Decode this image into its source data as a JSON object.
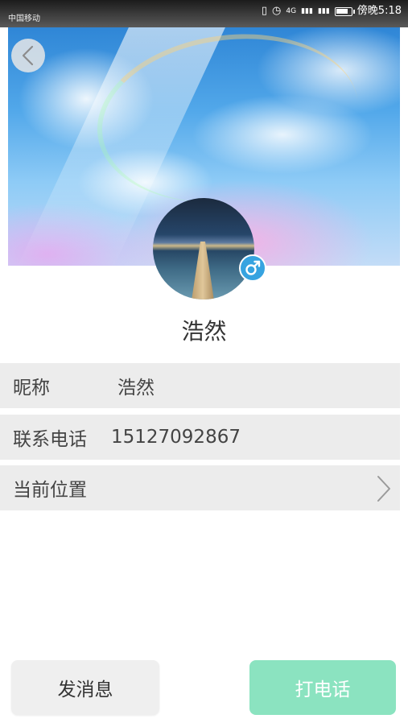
{
  "status_bar": {
    "carrier": "中国移动",
    "network": "4G",
    "signal_1": "▮▮▮",
    "signal_2": "▮▮▮",
    "time": "傍晚5:18"
  },
  "profile": {
    "name": "浩然",
    "gender_symbol": "♂"
  },
  "info": {
    "nickname_label": "昵称",
    "nickname_value": "浩然",
    "phone_label": "联系电话",
    "phone_value": "15127092867",
    "location_label": "当前位置"
  },
  "actions": {
    "message_label": "发消息",
    "call_label": "打电话"
  },
  "colors": {
    "call_button": "#8be3c0",
    "gender_badge": "#36a3e0",
    "row_background": "#ececec"
  },
  "icons": {
    "back": "back-icon",
    "gender": "male-icon",
    "location_chevron": "chevron-right-icon"
  }
}
